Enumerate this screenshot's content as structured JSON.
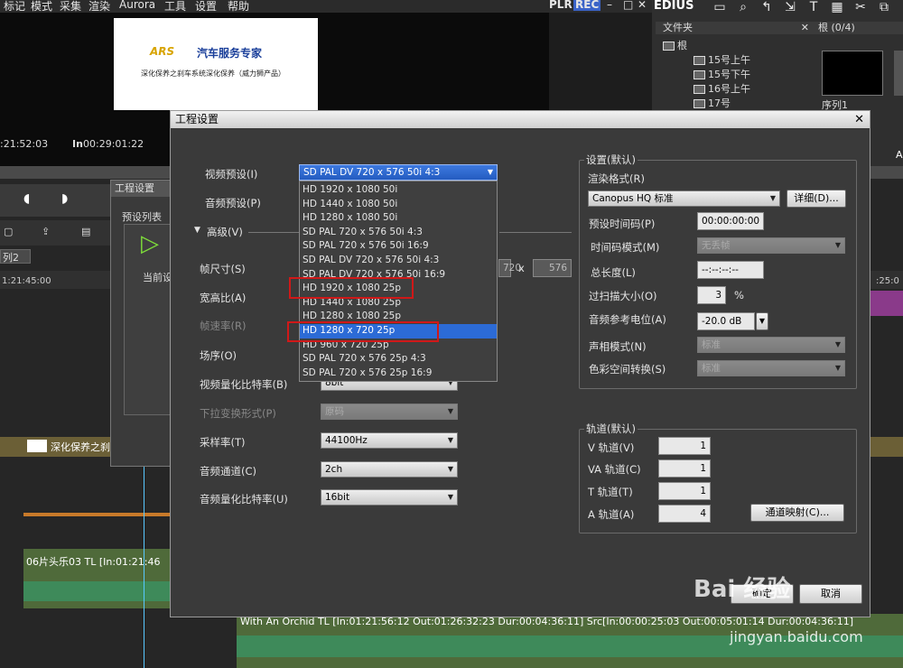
{
  "menubar": {
    "items": [
      "标记",
      "模式",
      "采集",
      "渲染",
      "Aurora",
      "工具",
      "设置",
      "帮助"
    ],
    "plr": "PLR",
    "rec": "REC"
  },
  "player": {
    "preview_logo_text": "汽车服务专家",
    "preview_logo_brand": "ARS",
    "preview_subtitle": "深化保养之刹车系统深化保养（威力狮产品）",
    "timecode_left": ":21:52:03",
    "timecode_in_label": "In",
    "timecode_in": "00:29:01:22"
  },
  "right_panel": {
    "app_name": "EDIUS",
    "folder_header": "文件夹",
    "bin_header": "根 (0/4)",
    "tree": [
      "根",
      "15号上午",
      "15号下午",
      "16号上午",
      "17号"
    ],
    "clip_label": "序列1",
    "clip_letter": "A"
  },
  "background": {
    "project_setting_title": "工程设置",
    "preset_list_label": "预设列表",
    "current_setting_label": "当前设",
    "seq_tab": "列2",
    "timeline_tc": "1:21:45:00",
    "timeline_tc_right": ":25:0",
    "clip1": "深化保养之刹",
    "clip2": "06片头乐03  TL [In:01:21:46",
    "clip3": "With An Orchid  TL [In:01:21:56:12 Out:01:26:32:23 Dur:00:04:36:11]  Src[In:00:00:25:03 Out:00:05:01:14 Dur:00:04:36:11]"
  },
  "dialog": {
    "title": "工程设置",
    "video_preset_label": "视频预设(I)",
    "video_preset_value": "SD PAL DV 720 x 576 50i 4:3",
    "audio_preset_label": "音频预设(P)",
    "advanced_label": "高级(V)",
    "frame_size_label": "帧尺寸(S)",
    "frame_w": "720",
    "frame_x": "x",
    "frame_h": "576",
    "aspect_label": "宽高比(A)",
    "frame_rate_label": "帧速率(R)",
    "field_order_label": "场序(O)",
    "video_quant_label": "视频量化比特率(B)",
    "video_quant_value": "8bit",
    "pulldown_label": "下拉变换形式(P)",
    "pulldown_value": "原码",
    "sample_rate_label": "采样率(T)",
    "sample_rate_value": "44100Hz",
    "audio_channel_label": "音频通道(C)",
    "audio_channel_value": "2ch",
    "audio_quant_label": "音频量化比特率(U)",
    "audio_quant_value": "16bit",
    "defaults": {
      "group_label": "设置(默认)",
      "render_format_label": "渲染格式(R)",
      "render_format_value": "Canopus HQ 标准",
      "detail_button": "详细(D)...",
      "preset_tc_label": "预设时间码(P)",
      "preset_tc_value": "00:00:00:00",
      "tc_mode_label": "时间码模式(M)",
      "tc_mode_value": "无丢帧",
      "total_length_label": "总长度(L)",
      "total_length_value": "--:--:--:--",
      "overscan_label": "过扫描大小(O)",
      "overscan_value": "3",
      "overscan_unit": "%",
      "audio_ref_label": "音频参考电位(A)",
      "audio_ref_value": "-20.0 dB",
      "sound_mode_label": "声相模式(N)",
      "sound_mode_value": "标准",
      "color_space_label": "色彩空间转换(S)",
      "color_space_value": "标准"
    },
    "tracks": {
      "group_label": "轨道(默认)",
      "v_label": "V 轨道(V)",
      "v_value": "1",
      "va_label": "VA 轨道(C)",
      "va_value": "1",
      "t_label": "T 轨道(T)",
      "t_value": "1",
      "a_label": "A 轨道(A)",
      "a_value": "4",
      "channel_map_button": "通道映射(C)..."
    },
    "ok_button": "确定",
    "cancel_button": "取消"
  },
  "dropdown_options": [
    "HD 1920 x 1080 50i",
    "HD 1440 x 1080 50i",
    "HD 1280 x 1080 50i",
    "SD PAL 720 x 576 50i 4:3",
    "SD PAL 720 x 576 50i 16:9",
    "SD PAL DV 720 x 576 50i 4:3",
    "SD PAL DV 720 x 576 50i 16:9",
    "HD 1920 x 1080 25p",
    "HD 1440 x 1080 25p",
    "HD 1280 x 1080 25p",
    "HD 1280 x 720 25p",
    "HD 960 x 720 25p",
    "SD PAL 720 x 576 25p 4:3",
    "SD PAL 720 x 576 25p 16:9"
  ],
  "dropdown_selected_index": 10,
  "highlight_color": "#2c6bd6",
  "annotation_color": "#d01818",
  "watermark": {
    "brand": "Bai 经验",
    "url": "jingyan.baidu.com"
  }
}
